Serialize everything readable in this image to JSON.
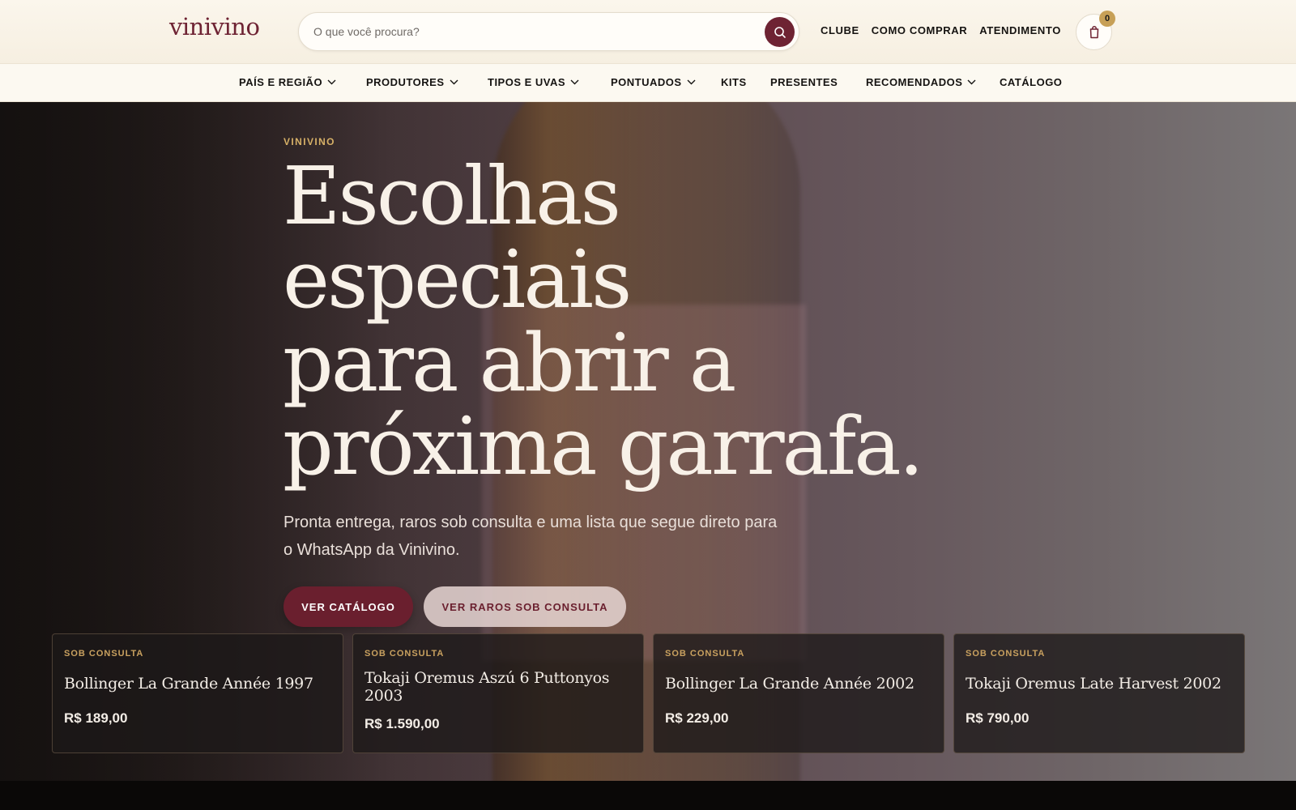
{
  "header": {
    "logo": "vinivino",
    "search": {
      "placeholder": "O que você procura?",
      "value": ""
    },
    "links": [
      "CLUBE",
      "COMO COMPRAR",
      "ATENDIMENTO"
    ],
    "cart_count": "0"
  },
  "nav": {
    "items": [
      {
        "label": "PAÍS E REGIÃO",
        "has_dropdown": true
      },
      {
        "label": "PRODUTORES",
        "has_dropdown": true
      },
      {
        "label": "TIPOS E UVAS",
        "has_dropdown": true
      },
      {
        "label": "PONTUADOS",
        "has_dropdown": true
      },
      {
        "label": "KITS",
        "has_dropdown": false
      },
      {
        "label": "PRESENTES",
        "has_dropdown": false
      },
      {
        "label": "RECOMENDADOS",
        "has_dropdown": true
      },
      {
        "label": "CATÁLOGO",
        "has_dropdown": false
      }
    ]
  },
  "hero": {
    "eyebrow": "VINIVINO",
    "headline_lines": [
      "Escolhas",
      "especiais",
      "para abrir a",
      "próxima garrafa."
    ],
    "subtitle_lines": [
      "Pronta entrega, raros sob consulta e uma lista que segue direto para",
      "o WhatsApp da Vinivino."
    ],
    "primary_button": "VER CATÁLOGO",
    "secondary_button": "VER RAROS SOB CONSULTA"
  },
  "products": [
    {
      "tag": "SOB CONSULTA",
      "name": "Bollinger La Grande Année 1997",
      "price": "R$ 189,00"
    },
    {
      "tag": "SOB CONSULTA",
      "name": "Tokaji Oremus Aszú 6 Puttonyos 2003",
      "price": "R$ 1.590,00"
    },
    {
      "tag": "SOB CONSULTA",
      "name": "Bollinger La Grande Année 2002",
      "price": "R$ 229,00"
    },
    {
      "tag": "SOB CONSULTA",
      "name": "Tokaji Oremus Late Harvest 2002",
      "price": "R$ 790,00"
    }
  ],
  "colors": {
    "brand": "#6e2333",
    "accent_gold": "#c7a057",
    "header_bg": "#f8f2e6",
    "nav_bg": "#fcf9f1"
  },
  "icons": {
    "search": "search-icon",
    "cart": "shopping-bag-icon",
    "dropdown": "chevron-down-icon"
  }
}
